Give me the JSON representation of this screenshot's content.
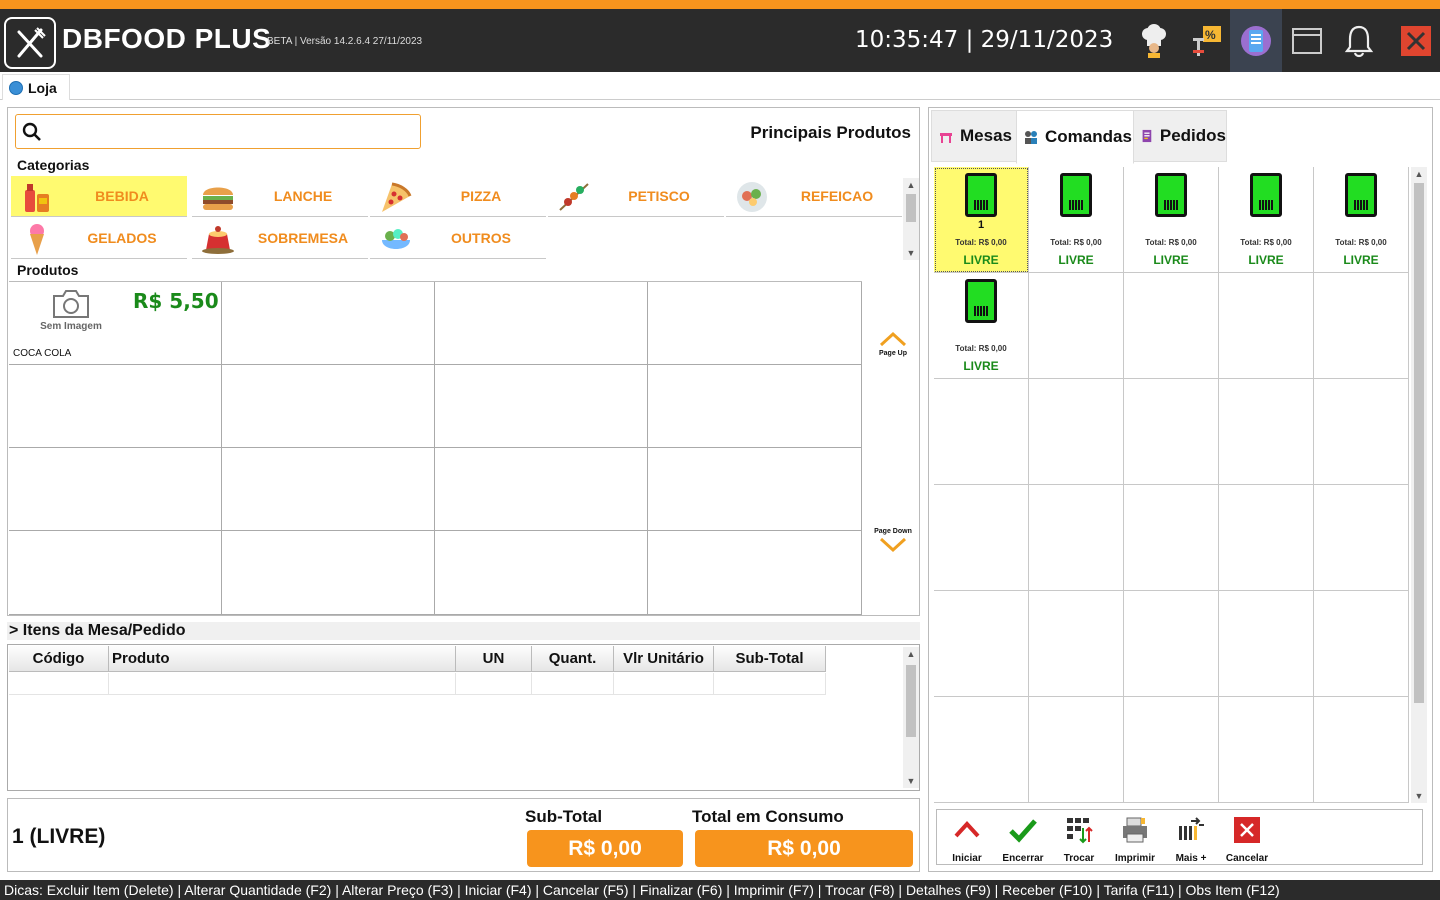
{
  "app": {
    "title": "DBFOOD PLUS",
    "version": "BETA | Versão 14.2.6.4 27/11/2023",
    "clock": "10:35:47 | 29/11/2023",
    "accent": "#f7941d",
    "toolbar_icons": [
      "chef-hat-icon",
      "discount-icon",
      "tablet-icon",
      "window-icon",
      "bell-icon",
      "close-icon"
    ]
  },
  "tabs": {
    "main": "Loja"
  },
  "left": {
    "section_title": "Principais Produtos",
    "categories_label": "Categorias",
    "products_label": "Produtos",
    "categories": [
      {
        "label": "BEBIDA",
        "icon": "drinks-icon"
      },
      {
        "label": "LANCHE",
        "icon": "burger-icon"
      },
      {
        "label": "PIZZA",
        "icon": "pizza-icon"
      },
      {
        "label": "PETISCO",
        "icon": "skewer-icon"
      },
      {
        "label": "REFEICAO",
        "icon": "meal-icon"
      },
      {
        "label": "GELADOS",
        "icon": "icecream-icon"
      },
      {
        "label": "SOBREMESA",
        "icon": "dessert-icon"
      },
      {
        "label": "OUTROS",
        "icon": "salad-icon"
      }
    ],
    "products": [
      {
        "name": "COCA COLA",
        "price": "R$ 5,50",
        "image_label": "Sem Imagem"
      }
    ],
    "page_up": "Page Up",
    "page_down": "Page Down"
  },
  "items": {
    "header": "> Itens da Mesa/Pedido",
    "columns": [
      "Código",
      "Produto",
      "UN",
      "Quant.",
      "Vlr Unitário",
      "Sub-Total"
    ]
  },
  "totals": {
    "status": "1 (LIVRE)",
    "subtotal_label": "Sub-Total",
    "subtotal_value": "R$ 0,00",
    "consumo_label": "Total em Consumo",
    "consumo_value": "R$ 0,00"
  },
  "right": {
    "tabs": [
      "Mesas",
      "Comandas",
      "Pedidos"
    ],
    "comandas": [
      {
        "number": "1",
        "total": "Total: R$ 0,00",
        "status": "LIVRE"
      },
      {
        "number": "",
        "total": "Total: R$ 0,00",
        "status": "LIVRE"
      },
      {
        "number": "",
        "total": "Total: R$ 0,00",
        "status": "LIVRE"
      },
      {
        "number": "",
        "total": "Total: R$ 0,00",
        "status": "LIVRE"
      },
      {
        "number": "",
        "total": "Total: R$ 0,00",
        "status": "LIVRE"
      },
      {
        "number": "",
        "total": "Total: R$ 0,00",
        "status": "LIVRE"
      }
    ],
    "actions": [
      {
        "label": "Iniciar",
        "icon": "chevron-up-icon"
      },
      {
        "label": "Encerrar",
        "icon": "check-icon"
      },
      {
        "label": "Trocar",
        "icon": "swap-icon"
      },
      {
        "label": "Imprimir",
        "icon": "printer-icon"
      },
      {
        "label": "Mais +",
        "icon": "more-icon"
      },
      {
        "label": "Cancelar",
        "icon": "cancel-icon"
      }
    ]
  },
  "footer": {
    "tips": "Dicas: Excluir Item (Delete) | Alterar Quantidade (F2) | Alterar Preço (F3) | Iniciar (F4) | Cancelar (F5) | Finalizar (F6) | Imprimir (F7) | Trocar (F8) | Detalhes (F9) | Receber (F10) | Tarifa (F11) | Obs Item (F12)"
  }
}
